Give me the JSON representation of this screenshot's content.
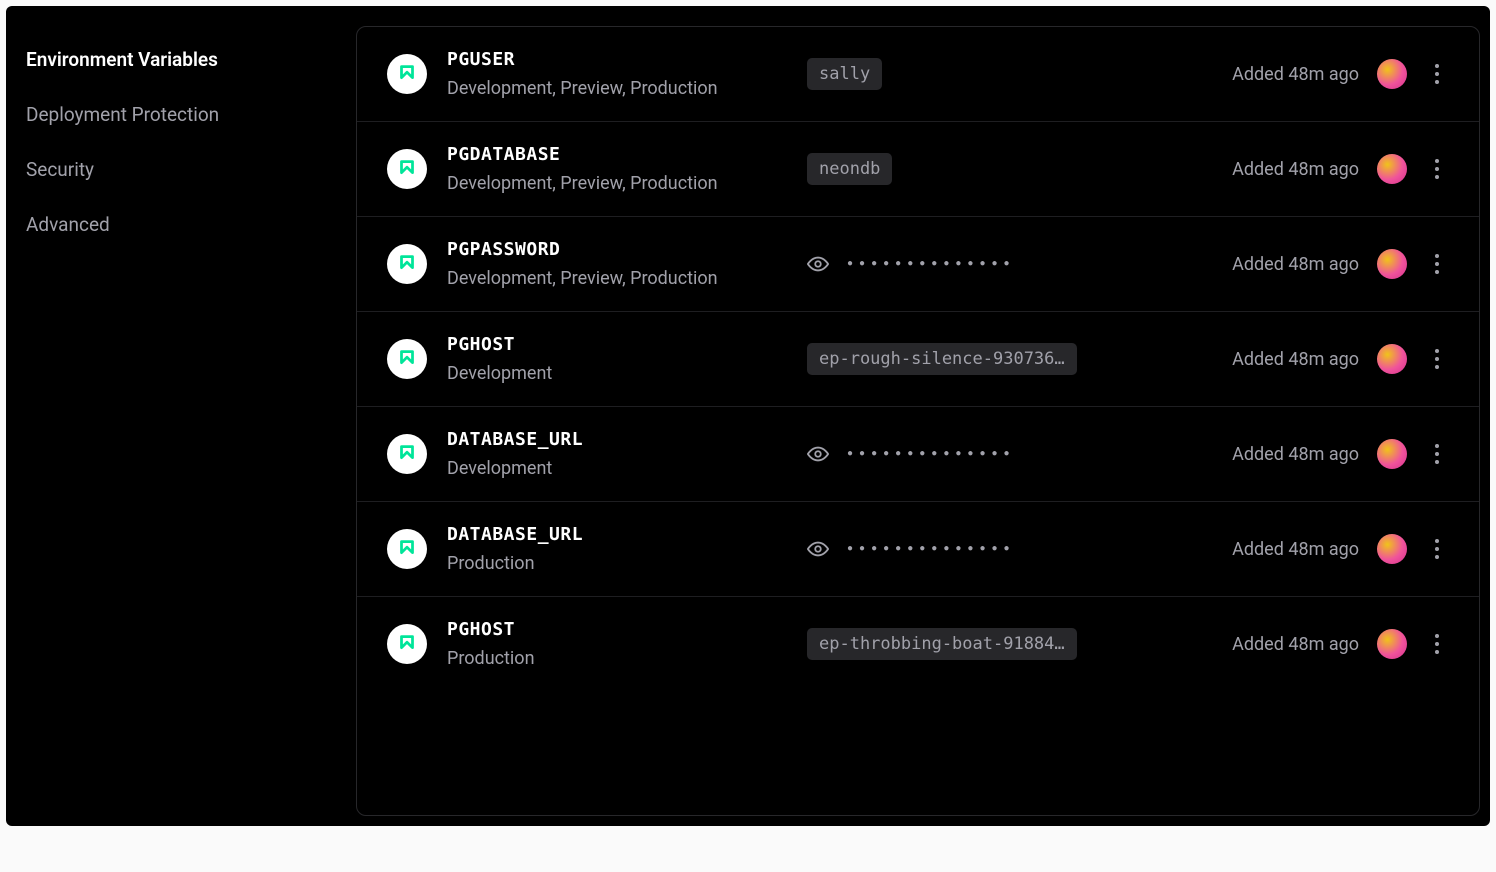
{
  "sidebar": {
    "items": [
      {
        "label": "Environment Variables",
        "active": true
      },
      {
        "label": "Deployment Protection",
        "active": false
      },
      {
        "label": "Security",
        "active": false
      },
      {
        "label": "Advanced",
        "active": false
      }
    ]
  },
  "secret_dots": "●●●●●●●●●●●●●●",
  "vars": [
    {
      "name": "PGUSER",
      "scope": "Development, Preview, Production",
      "value": "sally",
      "secret": false,
      "added": "Added 48m ago"
    },
    {
      "name": "PGDATABASE",
      "scope": "Development, Preview, Production",
      "value": "neondb",
      "secret": false,
      "added": "Added 48m ago"
    },
    {
      "name": "PGPASSWORD",
      "scope": "Development, Preview, Production",
      "value": "",
      "secret": true,
      "added": "Added 48m ago"
    },
    {
      "name": "PGHOST",
      "scope": "Development",
      "value": "ep-rough-silence-930736…",
      "secret": false,
      "added": "Added 48m ago"
    },
    {
      "name": "DATABASE_URL",
      "scope": "Development",
      "value": "",
      "secret": true,
      "added": "Added 48m ago"
    },
    {
      "name": "DATABASE_URL",
      "scope": "Production",
      "value": "",
      "secret": true,
      "added": "Added 48m ago"
    },
    {
      "name": "PGHOST",
      "scope": "Production",
      "value": "ep-throbbing-boat-91884…",
      "secret": false,
      "added": "Added 48m ago"
    }
  ]
}
